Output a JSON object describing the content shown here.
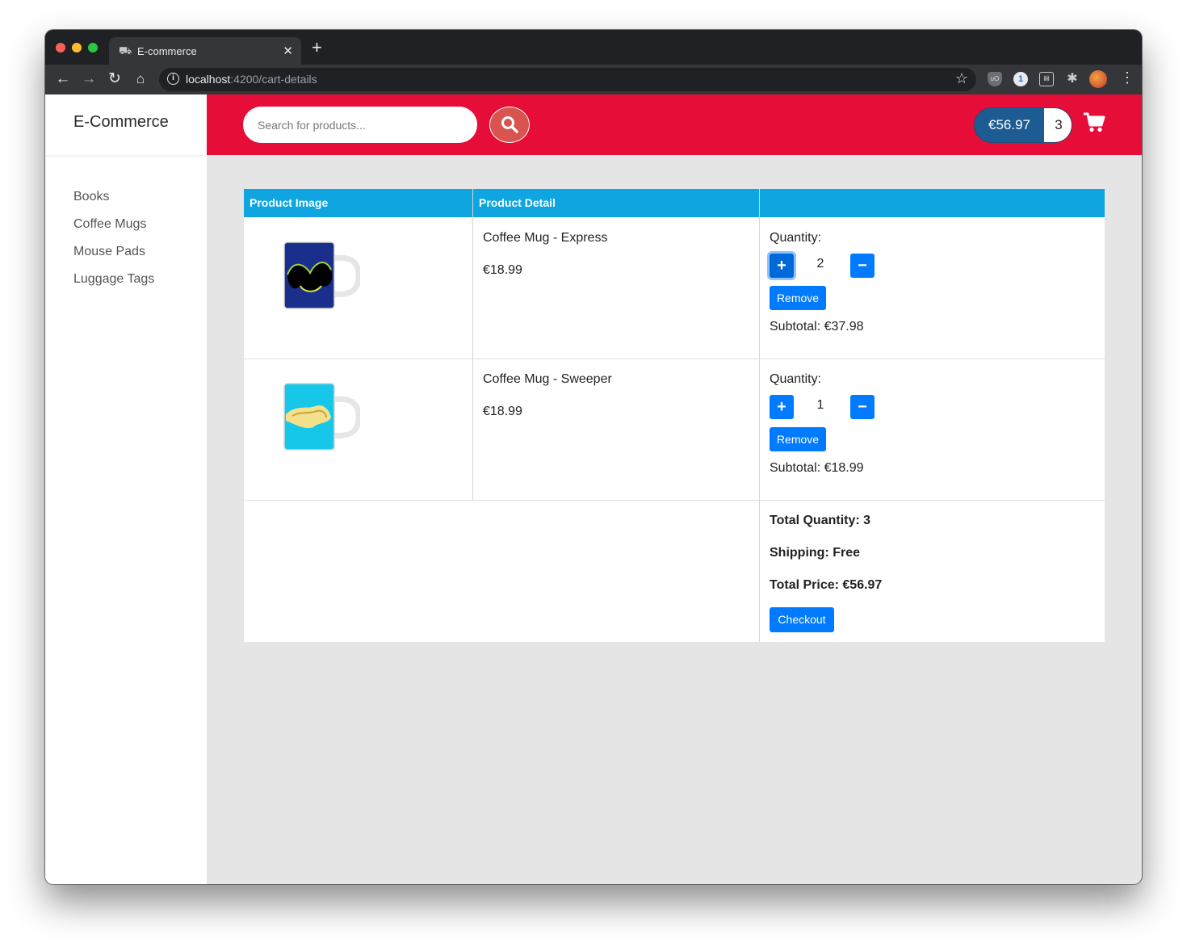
{
  "browser": {
    "tab_title": "E-commerce",
    "url_host": "localhost",
    "url_path": ":4200/cart-details"
  },
  "app": {
    "brand": "E-Commerce",
    "search_placeholder": "Search for products...",
    "cart_total": "€56.97",
    "cart_count": "3"
  },
  "sidebar": {
    "items": [
      {
        "label": "Books"
      },
      {
        "label": "Coffee Mugs"
      },
      {
        "label": "Mouse Pads"
      },
      {
        "label": "Luggage Tags"
      }
    ]
  },
  "table": {
    "headers": [
      "Product Image",
      "Product Detail",
      ""
    ],
    "rows": [
      {
        "name": "Coffee Mug - Express",
        "price": "€18.99",
        "quantity_label": "Quantity:",
        "quantity": "2",
        "remove_label": "Remove",
        "subtotal": "Subtotal: €37.98"
      },
      {
        "name": "Coffee Mug - Sweeper",
        "price": "€18.99",
        "quantity_label": "Quantity:",
        "quantity": "1",
        "remove_label": "Remove",
        "subtotal": "Subtotal: €18.99"
      }
    ],
    "summary": {
      "total_quantity": "Total Quantity: 3",
      "shipping": "Shipping: Free",
      "total_price": "Total Price: €56.97",
      "checkout_label": "Checkout"
    }
  },
  "colors": {
    "header_bg": "#e60d38",
    "table_header_bg": "#0ea5e0",
    "button_primary": "#007bff",
    "cart_total_bg": "#1d5c92"
  }
}
